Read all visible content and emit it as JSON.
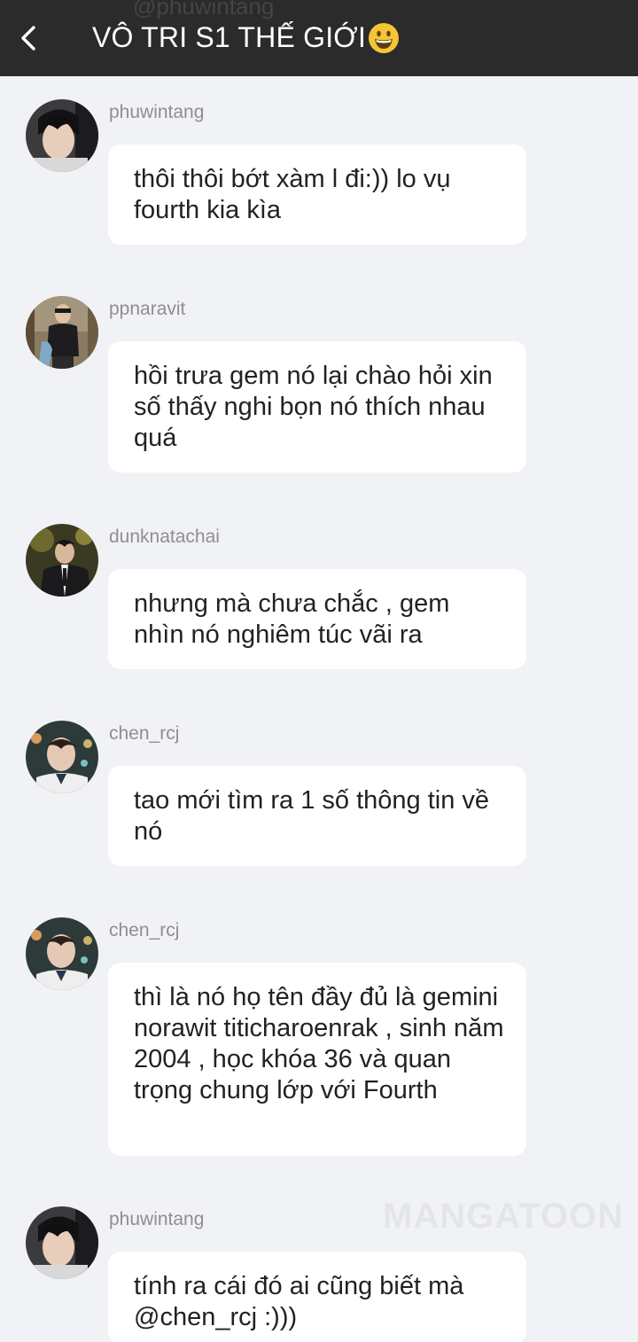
{
  "header": {
    "ghost_text": "@phuwintang",
    "title": "VÔ TRI S1 THẾ GIỚI",
    "title_emoji_icon": "grinning-face-icon",
    "background": "#2b2b2b"
  },
  "messages": [
    {
      "username": "phuwintang",
      "text": "thôi thôi bớt xàm l đi:)) lo vụ fourth kia kìa",
      "avatar": "phuwintang"
    },
    {
      "username": "ppnaravit",
      "text": "hồi trưa gem nó lại chào hỏi xin số thấy nghi bọn nó thích nhau quá",
      "avatar": "ppnaravit"
    },
    {
      "username": "dunknatachai",
      "text": "nhưng mà chưa chắc , gem nhìn nó nghiêm túc vãi ra",
      "avatar": "dunknatachai"
    },
    {
      "username": "chen_rcj",
      "text": "tao mới tìm ra 1 số thông tin về nó",
      "avatar": "chen_rcj"
    },
    {
      "username": "chen_rcj",
      "text": "thì là nó họ tên đầy đủ là gemini norawit titicharoenrak , sinh năm 2004 , học khóa 36 và quan trọng chung lớp với Fourth",
      "avatar": "chen_rcj"
    },
    {
      "username": "phuwintang",
      "text": "tính ra cái đó ai cũng biết mà @chen_rcj :)))",
      "avatar": "phuwintang"
    }
  ],
  "watermark": "MANGATOON",
  "colors": {
    "page_bg": "#f1f2f6",
    "bubble_bg": "#ffffff",
    "username": "#8e8e93",
    "text": "#222222"
  }
}
